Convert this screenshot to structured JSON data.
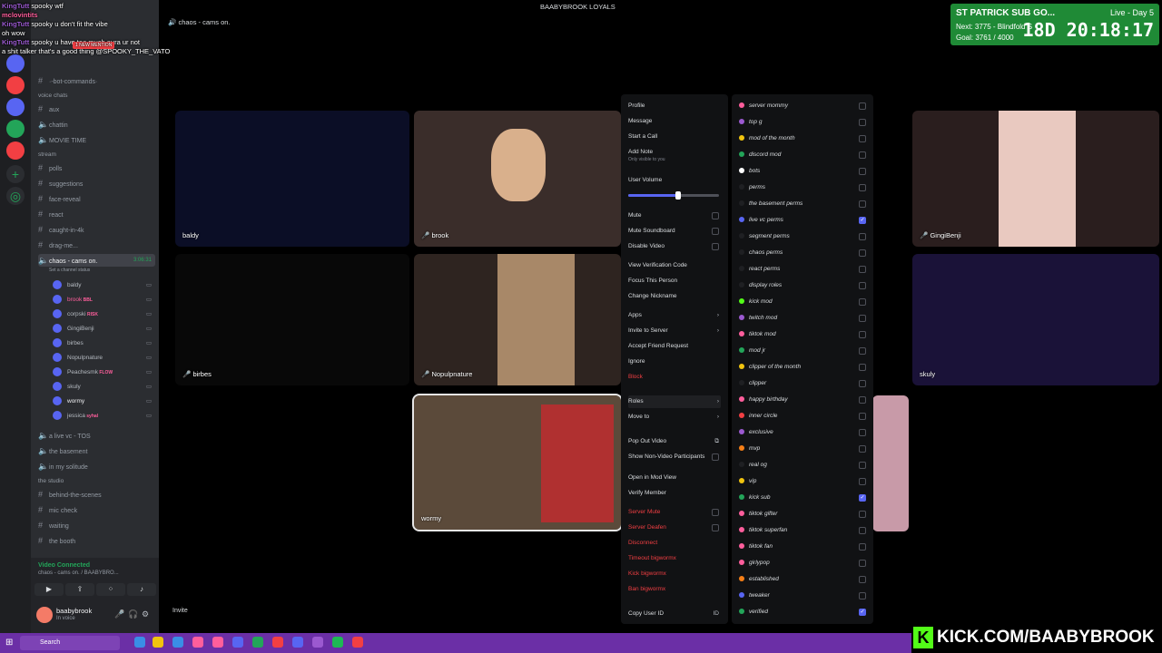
{
  "chat": {
    "lines": [
      {
        "user": "KingTutt",
        "text": "spooky wtf"
      },
      {
        "user": "mclovintits",
        "text": ""
      },
      {
        "user": "KingTutt",
        "text": "spooky u don't fit the vibe"
      },
      {
        "user": "",
        "text": "oh wow"
      },
      {
        "user": "KingTutt",
        "text": "spooky u have too much aura ur not"
      },
      {
        "user": "",
        "text": "a shit talker that's a good thing @SPOOKY_THE_VATO"
      }
    ],
    "mention_badge": "1 NEW MENTION"
  },
  "server": {
    "title": "BAABYBROOK LOYALS"
  },
  "channels": [
    {
      "name": "·-bot-commands·",
      "type": "text"
    },
    {
      "name": "voice chats",
      "type": "category"
    },
    {
      "name": "aux",
      "type": "text"
    },
    {
      "name": "chattin",
      "type": "voice"
    },
    {
      "name": "MOVIE TIME",
      "type": "voice"
    },
    {
      "name": "stream",
      "type": "category"
    },
    {
      "name": "polls",
      "type": "text"
    },
    {
      "name": "suggestions",
      "type": "text"
    },
    {
      "name": "face-reveal",
      "type": "text"
    },
    {
      "name": "react",
      "type": "text"
    },
    {
      "name": "caught-in-4k",
      "type": "text"
    },
    {
      "name": "drag-me...",
      "type": "text"
    },
    {
      "name": "chaos - cams on.",
      "type": "voice",
      "active": true,
      "time": "3:06:31",
      "status": "Set a channel status"
    }
  ],
  "voice_users": [
    {
      "name": "baldy",
      "color": "#b5bac1"
    },
    {
      "name": "brook",
      "tag": "BBL",
      "color": "#ff5e9c"
    },
    {
      "name": "corpski",
      "tag": "RISK",
      "color": "#b5bac1"
    },
    {
      "name": "GingiBenji",
      "color": "#b5bac1"
    },
    {
      "name": "birbes",
      "color": "#b5bac1"
    },
    {
      "name": "Nopulpnature",
      "color": "#b5bac1"
    },
    {
      "name": "Peachesmk",
      "tag": "FLOW",
      "color": "#b5bac1"
    },
    {
      "name": "skuly",
      "color": "#b5bac1"
    },
    {
      "name": "wormy",
      "color": "#f2f3f5"
    },
    {
      "name": "jessica",
      "tag": "syhal",
      "color": "#b5bac1"
    }
  ],
  "channels_after": [
    {
      "name": "a live vc - TOS",
      "type": "voice"
    },
    {
      "name": "the basement",
      "type": "voice"
    },
    {
      "name": "in my solitude",
      "type": "voice"
    },
    {
      "name": "the studio",
      "type": "category"
    },
    {
      "name": "behind-the-scenes",
      "type": "text"
    },
    {
      "name": "mic check",
      "type": "text"
    },
    {
      "name": "waiting",
      "type": "text"
    },
    {
      "name": "the booth",
      "type": "text"
    }
  ],
  "voice_status": {
    "title": "Video Connected",
    "sub": "chaos - cams on. / BAABYBRO..."
  },
  "user": {
    "name": "baabybrook",
    "status": "In voice"
  },
  "stage": {
    "channel_title": "chaos - cams on.",
    "tiles": [
      {
        "label": "baldy"
      },
      {
        "label": "brook"
      },
      {
        "label": "GingiBenji"
      },
      {
        "label": "birbes"
      },
      {
        "label": "Nopulpnature"
      },
      {
        "label": "skuly"
      },
      {
        "label": "wormy"
      }
    ],
    "invite": "Invite"
  },
  "subgoal": {
    "title": "ST PATRICK SUB GO...",
    "next": "Next: 3775 - Blindfold S",
    "goal": "Goal: 3761 / 4000",
    "live": "Live - Day 5",
    "timer": "18D 20:18:17"
  },
  "context_menu": {
    "items": [
      {
        "label": "Profile"
      },
      {
        "label": "Message"
      },
      {
        "label": "Start a Call"
      },
      {
        "label": "Add Note",
        "sub": "Only visible to you"
      },
      {
        "label": "User Volume"
      },
      {
        "label": "Mute",
        "checkbox": true
      },
      {
        "label": "Mute Soundboard",
        "checkbox": true
      },
      {
        "label": "Disable Video",
        "checkbox": true
      },
      {
        "label": "View Verification Code"
      },
      {
        "label": "Focus This Person"
      },
      {
        "label": "Change Nickname"
      },
      {
        "label": "Apps",
        "arrow": true
      },
      {
        "label": "Invite to Server",
        "arrow": true
      },
      {
        "label": "Accept Friend Request"
      },
      {
        "label": "Ignore"
      },
      {
        "label": "Block",
        "danger": true
      },
      {
        "label": "Roles",
        "arrow": true
      },
      {
        "label": "Move to",
        "arrow": true
      },
      {
        "label": "Pop Out Video"
      },
      {
        "label": "Show Non-Video Participants",
        "checkbox": true
      },
      {
        "label": "Open in Mod View"
      },
      {
        "label": "Verify Member"
      },
      {
        "label": "Server Mute",
        "checkbox": true,
        "danger": true
      },
      {
        "label": "Server Deafen",
        "checkbox": true,
        "danger": true
      },
      {
        "label": "Disconnect",
        "danger": true
      },
      {
        "label": "Timeout bigwormx",
        "danger": true
      },
      {
        "label": "Kick bigwormx",
        "danger": true
      },
      {
        "label": "Ban bigwormx",
        "danger": true
      },
      {
        "label": "Copy User ID"
      }
    ],
    "volume": 0.55
  },
  "roles": [
    {
      "name": "server mommy",
      "color": "#ff5e9c",
      "checked": false
    },
    {
      "name": "top g",
      "color": "#9b59d0",
      "checked": false
    },
    {
      "name": "mod of the month",
      "color": "#f1c40f",
      "checked": false
    },
    {
      "name": "discord mod",
      "color": "#23a559",
      "checked": false
    },
    {
      "name": "bots",
      "color": "#ffffff",
      "checked": false
    },
    {
      "name": "perms",
      "color": "#1f2023",
      "checked": false
    },
    {
      "name": "the basement perms",
      "color": "#1f2023",
      "checked": false
    },
    {
      "name": "live vc perms",
      "color": "#5865f2",
      "checked": true
    },
    {
      "name": "segment perms",
      "color": "#1f2023",
      "checked": false
    },
    {
      "name": "chaos perms",
      "color": "#1f2023",
      "checked": false
    },
    {
      "name": "react perms",
      "color": "#1f2023",
      "checked": false
    },
    {
      "name": "display roles",
      "color": "#1f2023",
      "checked": false
    },
    {
      "name": "kick mod",
      "color": "#53fc18",
      "checked": false
    },
    {
      "name": "twitch mod",
      "color": "#9b59d0",
      "checked": false
    },
    {
      "name": "tiktok mod",
      "color": "#ff5e9c",
      "checked": false
    },
    {
      "name": "mod jr",
      "color": "#23a559",
      "checked": false
    },
    {
      "name": "clipper of the month",
      "color": "#f1c40f",
      "checked": false
    },
    {
      "name": "clipper",
      "color": "#1f2023",
      "checked": false
    },
    {
      "name": "happy birthday",
      "color": "#ff5e9c",
      "checked": false
    },
    {
      "name": "inner circle",
      "color": "#f23f43",
      "checked": false
    },
    {
      "name": "exclusive",
      "color": "#9b59d0",
      "checked": false
    },
    {
      "name": "mvp",
      "color": "#f57f17",
      "checked": false
    },
    {
      "name": "real og",
      "color": "#1f2023",
      "checked": false
    },
    {
      "name": "vip",
      "color": "#f1c40f",
      "checked": false
    },
    {
      "name": "kick sub",
      "color": "#23a559",
      "checked": true
    },
    {
      "name": "tiktok gifter",
      "color": "#ff5e9c",
      "checked": false
    },
    {
      "name": "tiktok superfan",
      "color": "#ff5e9c",
      "checked": false
    },
    {
      "name": "tiktok fan",
      "color": "#ff5e9c",
      "checked": false
    },
    {
      "name": "girlypop",
      "color": "#ff5e9c",
      "checked": false
    },
    {
      "name": "established",
      "color": "#f57f17",
      "checked": false
    },
    {
      "name": "tweaker",
      "color": "#5865f2",
      "checked": false
    },
    {
      "name": "verified",
      "color": "#23a559",
      "checked": true
    }
  ],
  "kick_banner": "KICK.COM/BAABYBROOK",
  "taskbar": {
    "search": "Search"
  }
}
